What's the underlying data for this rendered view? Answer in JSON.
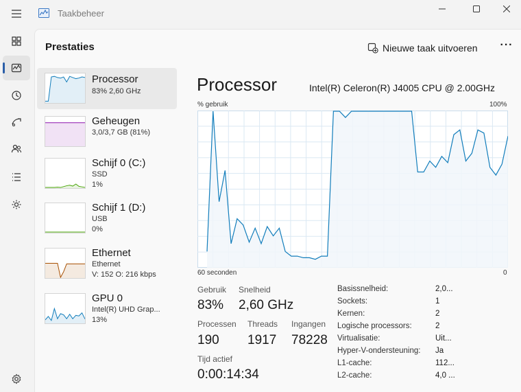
{
  "window": {
    "title": "Taakbeheer"
  },
  "page": {
    "title": "Prestaties",
    "run_new_task": "Nieuwe taak uitvoeren",
    "more": "···"
  },
  "rail": {
    "icons": [
      "processes-icon",
      "performance-icon",
      "app-history-icon",
      "startup-apps-icon",
      "users-icon",
      "details-icon",
      "services-icon",
      "settings-icon"
    ]
  },
  "devices": [
    {
      "name": "Processor",
      "sub1": "83% 2,60 GHz",
      "sub2": "",
      "color": "#117dbb",
      "graph": [
        4,
        4,
        90,
        92,
        88,
        86,
        90,
        72,
        92,
        88,
        84,
        86,
        90,
        88
      ]
    },
    {
      "name": "Geheugen",
      "sub1": "3,0/3,7 GB (81%)",
      "sub2": "",
      "color": "#8b12ae",
      "graph": [
        81,
        81,
        81,
        81,
        81,
        81,
        81,
        81,
        81,
        81,
        81,
        81,
        81,
        81
      ]
    },
    {
      "name": "Schijf 0 (C:)",
      "sub1": "SSD",
      "sub2": "1%",
      "color": "#4da60c",
      "graph": [
        0,
        0,
        0,
        0,
        1,
        0,
        3,
        6,
        8,
        5,
        12,
        4,
        2,
        0
      ]
    },
    {
      "name": "Schijf 1 (D:)",
      "sub1": "USB",
      "sub2": "0%",
      "color": "#4da60c",
      "graph": [
        0,
        0,
        0,
        0,
        0,
        0,
        0,
        0,
        0,
        0,
        0,
        0,
        0,
        0
      ]
    },
    {
      "name": "Ethernet",
      "sub1": "Ethernet",
      "sub2": "V: 152 O: 216 kbps",
      "color": "#a74f01",
      "graph": [
        50,
        50,
        50,
        50,
        50,
        0,
        20,
        48,
        48,
        48,
        48,
        48,
        48,
        48
      ]
    },
    {
      "name": "GPU 0",
      "sub1": "Intel(R) UHD Grap...",
      "sub2": "13%",
      "color": "#117dbb",
      "graph": [
        10,
        22,
        8,
        50,
        14,
        32,
        28,
        14,
        30,
        14,
        26,
        24,
        35,
        13
      ]
    }
  ],
  "processor": {
    "title": "Processor",
    "model": "Intel(R) Celeron(R) J4005 CPU @ 2.00GHz",
    "y_label": "% gebruik",
    "y_max_label": "100%",
    "x_left_label": "60 seconden",
    "x_right_label": "0",
    "line_color": "#117dbb",
    "fill_color": "#f1f6fa",
    "grid_color": "#dae8f3",
    "usage_history": [
      10,
      100,
      42,
      62,
      15,
      31,
      27,
      16,
      25,
      15,
      26,
      20,
      25,
      10,
      7,
      7,
      6,
      6,
      5,
      7,
      7,
      100,
      100,
      96,
      100,
      100,
      100,
      100,
      100,
      100,
      100,
      100,
      100,
      100,
      100,
      61,
      61,
      68,
      64,
      71,
      67,
      85,
      88,
      68,
      73,
      88,
      86,
      64,
      59,
      66,
      84
    ],
    "stats": {
      "usage_label": "Gebruik",
      "usage": "83%",
      "speed_label": "Snelheid",
      "speed": "2,60 GHz",
      "processes_label": "Processen",
      "processes": "190",
      "threads_label": "Threads",
      "threads": "1917",
      "handles_label": "Ingangen",
      "handles": "78228",
      "uptime_label": "Tijd actief",
      "uptime": "0:00:14:34"
    },
    "specs": [
      {
        "label": "Basissnelheid:",
        "value": "2,0..."
      },
      {
        "label": "Sockets:",
        "value": "1"
      },
      {
        "label": "Kernen:",
        "value": "2"
      },
      {
        "label": "Logische processors:",
        "value": "2"
      },
      {
        "label": "Virtualisatie:",
        "value": "Uit..."
      },
      {
        "label": "Hyper-V-ondersteuning:",
        "value": "Ja"
      },
      {
        "label": "L1-cache:",
        "value": "112..."
      },
      {
        "label": "L2-cache:",
        "value": "4,0 ..."
      }
    ]
  }
}
